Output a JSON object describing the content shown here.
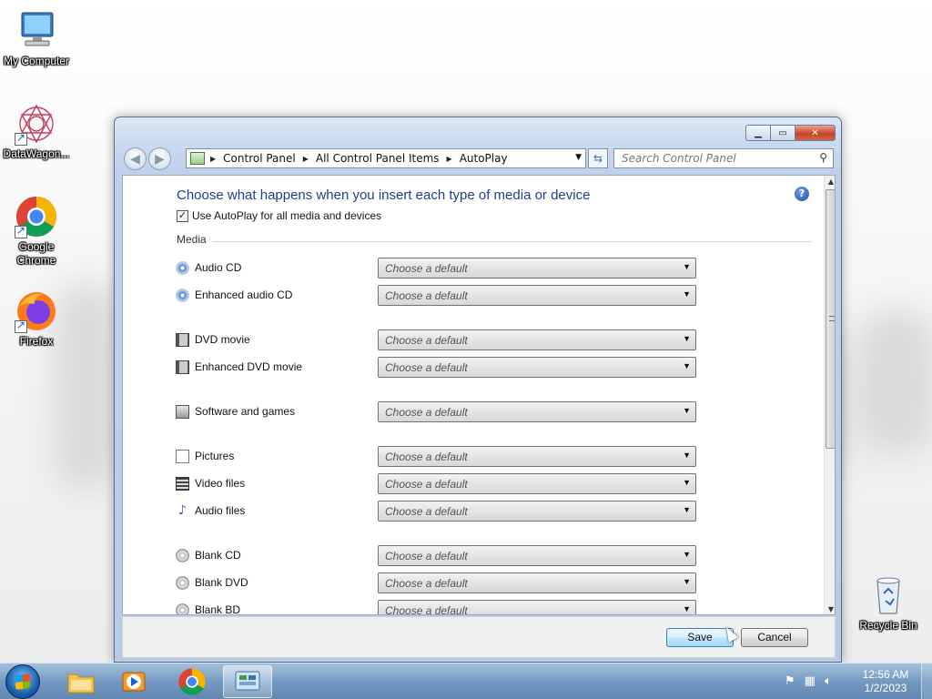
{
  "desktop": {
    "icons": [
      {
        "label": "My Computer",
        "icon": "computer-icon"
      },
      {
        "label": "DataWagon...",
        "icon": "datawagon-icon"
      },
      {
        "label": "Google Chrome",
        "icon": "chrome-icon"
      },
      {
        "label": "Firefox",
        "icon": "firefox-icon"
      },
      {
        "label": "Recycle Bin",
        "icon": "recycle-bin-icon"
      }
    ]
  },
  "window": {
    "breadcrumbs": [
      "Control Panel",
      "All Control Panel Items",
      "AutoPlay"
    ],
    "search_placeholder": "Search Control Panel",
    "heading": "Choose what happens when you insert each type of media or device",
    "autoplay_checkbox_label": "Use AutoPlay for all media and devices",
    "autoplay_checked": true,
    "section_label": "Media",
    "rows": [
      {
        "label": "Audio CD",
        "value": "Choose a default",
        "icon": "audio-cd-icon"
      },
      {
        "label": "Enhanced audio CD",
        "value": "Choose a default",
        "icon": "enhanced-audio-cd-icon"
      },
      {
        "label": "DVD movie",
        "value": "Choose a default",
        "icon": "dvd-movie-icon"
      },
      {
        "label": "Enhanced DVD movie",
        "value": "Choose a default",
        "icon": "enhanced-dvd-icon"
      },
      {
        "label": "Software and games",
        "value": "Choose a default",
        "icon": "software-icon"
      },
      {
        "label": "Pictures",
        "value": "Choose a default",
        "icon": "pictures-icon"
      },
      {
        "label": "Video files",
        "value": "Choose a default",
        "icon": "video-files-icon"
      },
      {
        "label": "Audio files",
        "value": "Choose a default",
        "icon": "audio-files-icon"
      },
      {
        "label": "Blank CD",
        "value": "Choose a default",
        "icon": "blank-cd-icon"
      },
      {
        "label": "Blank DVD",
        "value": "Choose a default",
        "icon": "blank-dvd-icon"
      },
      {
        "label": "Blank BD",
        "value": "Choose a default",
        "icon": "blank-bd-icon"
      }
    ],
    "save_label": "Save",
    "cancel_label": "Cancel"
  },
  "taskbar": {
    "time": "12:56 AM",
    "date": "1/2/2023"
  }
}
